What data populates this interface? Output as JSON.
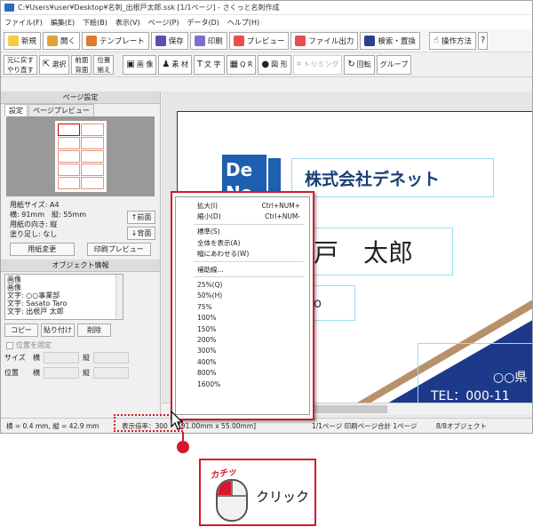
{
  "titlebar": {
    "text": "C:¥Users¥user¥Desktop¥名刺_出根戸太郎.ssk  [1/1ページ] - さくっと名刺作成"
  },
  "menubar": {
    "items": [
      "ファイル(F)",
      "編集(E)",
      "下絵(B)",
      "表示(V)",
      "ページ(P)",
      "データ(D)",
      "ヘルプ(H)"
    ]
  },
  "toolbar": {
    "new": "新規",
    "open": "開く",
    "template": "テンプレート",
    "save": "保存",
    "print": "印刷",
    "preview": "プレビュー",
    "export": "ファイル出力",
    "search": "検索・置換",
    "help": "操作方法"
  },
  "toolbar2": {
    "undo": "元に戻す",
    "redo": "やり直す",
    "select": "選択",
    "front": "前面",
    "back": "背面",
    "align1": "位置",
    "align2": "揃え",
    "image": "画 像",
    "material": "素 材",
    "text": "文 字",
    "qr": "Q R",
    "shape": "図 形",
    "trim": "トリミング",
    "rotate": "回転",
    "group": "グループ"
  },
  "left_panel": {
    "head": "ページ設定",
    "tabs": [
      "設定",
      "ページプレビュー"
    ],
    "info": [
      "用紙サイズ: A4",
      "横: 91mm　縦: 55mm",
      "用紙の向き: 縦",
      "塗り足し: なし"
    ],
    "paper_change": "用紙変更",
    "print_preview": "印刷プレビュー",
    "obj_head": "オブジェクト情報",
    "objects": [
      "画像",
      "画像",
      "文字: ○○事業部",
      "文字: Sasato Taro",
      "文字: 出根戸 太郎"
    ],
    "bring_front": "↑前面",
    "send_back": "↓背面",
    "copy": "コピー",
    "paste": "貼り付け",
    "delete": "削除",
    "lock": "位置を固定",
    "size": "サイズ",
    "pos": "位置",
    "w": "横",
    "h": "縦"
  },
  "card": {
    "company": "株式会社デネット",
    "name": "出根戸　太郎",
    "name_visible": "戸　太郎",
    "en": "Taro",
    "en_visible": "ro",
    "addr1": "○○県",
    "tel": "TEL：000-11"
  },
  "context_menu": {
    "items": [
      {
        "label": "拡大(I)",
        "shortcut": "Ctrl+NUM+"
      },
      {
        "label": "縮小(D)",
        "shortcut": "Ctrl+NUM-"
      },
      {
        "sep": true
      },
      {
        "label": "標準(S)",
        "shortcut": ""
      },
      {
        "label": "全体を表示(A)",
        "shortcut": ""
      },
      {
        "label": "幅にあわせる(W)",
        "shortcut": ""
      },
      {
        "sep": true
      },
      {
        "label": "補助線...",
        "shortcut": ""
      },
      {
        "sep": true
      },
      {
        "label": "25%(Q)",
        "shortcut": ""
      },
      {
        "label": "50%(H)",
        "shortcut": ""
      },
      {
        "label": "75%",
        "shortcut": ""
      },
      {
        "label": "100%",
        "shortcut": ""
      },
      {
        "label": "150%",
        "shortcut": ""
      },
      {
        "label": "200%",
        "shortcut": ""
      },
      {
        "label": "300%",
        "shortcut": ""
      },
      {
        "label": "400%",
        "shortcut": ""
      },
      {
        "label": "800%",
        "shortcut": ""
      },
      {
        "label": "1600%",
        "shortcut": ""
      }
    ]
  },
  "statusbar": {
    "coords": "横 = 0.4 mm, 縦 = 42.9 mm",
    "zoom": "表示倍率：300",
    "size": "[91.00mm x 55.00mm]",
    "page": "1/1ページ 印刷ページ合計 1ページ",
    "objects": "8/8オブジェクト"
  },
  "callout": {
    "sound": "カチッ",
    "label": "クリック"
  },
  "colors": {
    "accent": "#d6182c",
    "brand_blue": "#1a3f79",
    "cyan_frame": "#9adcef"
  }
}
